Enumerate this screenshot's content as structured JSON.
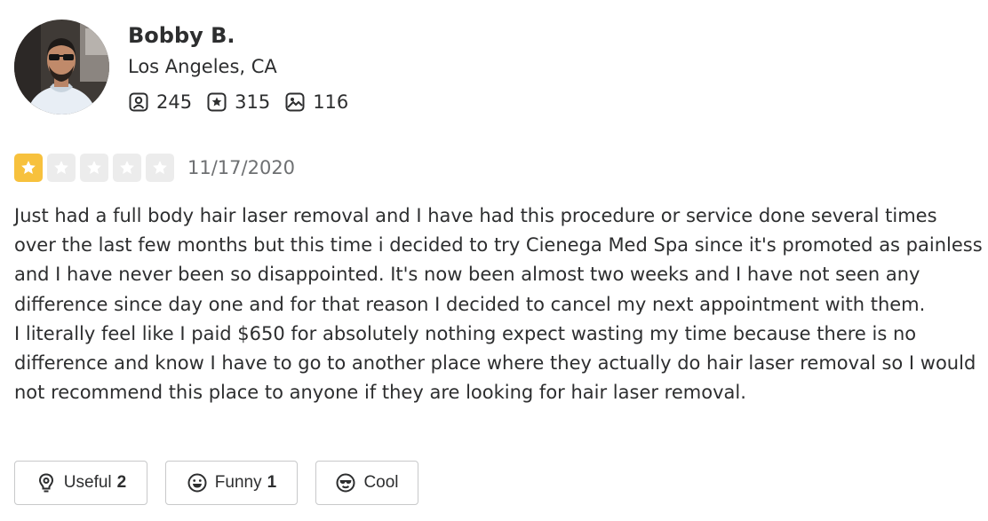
{
  "user": {
    "name": "Bobby B.",
    "location": "Los Angeles, CA",
    "stats": {
      "friends": "245",
      "reviews": "315",
      "photos": "116"
    }
  },
  "review": {
    "rating": 1,
    "max_rating": 5,
    "date": "11/17/2020",
    "paragraphs": [
      "Just had a full body hair laser removal and I have had this procedure or service done several times over the last few months but this time i decided to try Cienega Med Spa since it's promoted as painless and I have never been so disappointed. It's now been almost two weeks and I have not seen any difference since day one and for that reason I decided to cancel my next appointment with them.",
      "I literally feel like I paid $650 for absolutely nothing expect wasting my time because there is no difference and know I have to go to another place where they actually do hair laser removal so I would not recommend this place to anyone if they are looking for hair laser removal."
    ]
  },
  "reactions": {
    "useful": {
      "label": "Useful",
      "count": "2"
    },
    "funny": {
      "label": "Funny",
      "count": "1"
    },
    "cool": {
      "label": "Cool"
    }
  },
  "icons": {
    "friends": "friends-icon",
    "reviews": "review-star-icon",
    "photos": "photo-icon",
    "useful": "lightbulb-icon",
    "funny": "smile-icon",
    "cool": "sunglasses-face-icon",
    "star": "star-icon"
  },
  "colors": {
    "star_filled": "#f7c13d",
    "star_empty": "#ececec",
    "text": "#2d2e2f",
    "muted_text": "#6e7072",
    "button_border": "#c8c9ca"
  }
}
